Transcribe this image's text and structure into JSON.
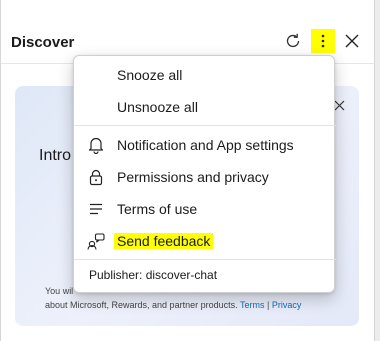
{
  "header": {
    "title": "Discover",
    "icons": [
      "refresh-icon",
      "more-options-icon",
      "close-icon"
    ],
    "highlight_color": "#ffff00"
  },
  "card": {
    "intro_text": "Intro",
    "footer_line1": "You wil",
    "footer_line2_prefix": "about Microsoft, Rewards, and partner products.",
    "terms_link": "Terms",
    "separator": "|",
    "privacy_link": "Privacy",
    "link_color": "#0f6cbd"
  },
  "menu": {
    "snooze_all": "Snooze all",
    "unsnooze_all": "Unsnooze all",
    "notification_settings": "Notification and App settings",
    "permissions_privacy": "Permissions and privacy",
    "terms_of_use": "Terms of use",
    "send_feedback": "Send feedback",
    "publisher": "Publisher: discover-chat",
    "icons": [
      "bell-icon",
      "lock-icon",
      "list-icon",
      "feedback-icon"
    ]
  }
}
